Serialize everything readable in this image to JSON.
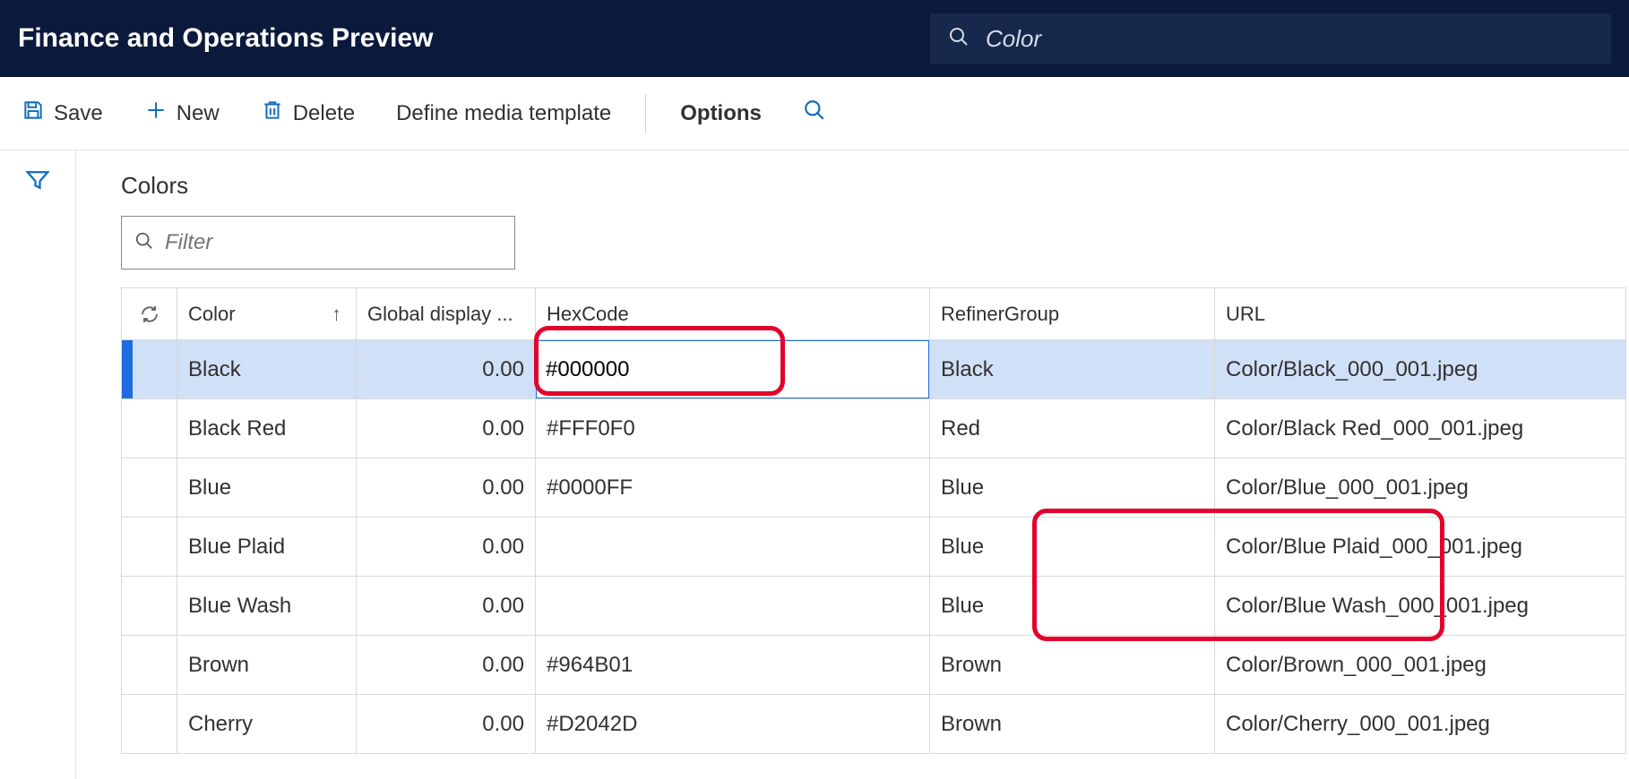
{
  "header": {
    "title": "Finance and Operations Preview",
    "search_placeholder": "Color"
  },
  "toolbar": {
    "save_label": "Save",
    "new_label": "New",
    "delete_label": "Delete",
    "define_media_label": "Define media template",
    "options_label": "Options"
  },
  "content": {
    "title": "Colors",
    "filter_placeholder": "Filter"
  },
  "table": {
    "columns": {
      "color": "Color",
      "global": "Global display ...",
      "hex": "HexCode",
      "refiner": "RefinerGroup",
      "url": "URL"
    },
    "rows": [
      {
        "color": "Black",
        "global": "0.00",
        "hex": "#000000",
        "refiner": "Black",
        "url": "Color/Black_000_001.jpeg",
        "selected": true
      },
      {
        "color": "Black Red",
        "global": "0.00",
        "hex": "#FFF0F0",
        "refiner": "Red",
        "url": "Color/Black Red_000_001.jpeg",
        "selected": false
      },
      {
        "color": "Blue",
        "global": "0.00",
        "hex": "#0000FF",
        "refiner": "Blue",
        "url": "Color/Blue_000_001.jpeg",
        "selected": false
      },
      {
        "color": "Blue Plaid",
        "global": "0.00",
        "hex": "",
        "refiner": "Blue",
        "url": "Color/Blue Plaid_000_001.jpeg",
        "selected": false
      },
      {
        "color": "Blue Wash",
        "global": "0.00",
        "hex": "",
        "refiner": "Blue",
        "url": "Color/Blue Wash_000_001.jpeg",
        "selected": false
      },
      {
        "color": "Brown",
        "global": "0.00",
        "hex": "#964B01",
        "refiner": "Brown",
        "url": "Color/Brown_000_001.jpeg",
        "selected": false
      },
      {
        "color": "Cherry",
        "global": "0.00",
        "hex": "#D2042D",
        "refiner": "Brown",
        "url": "Color/Cherry_000_001.jpeg",
        "selected": false
      }
    ]
  }
}
